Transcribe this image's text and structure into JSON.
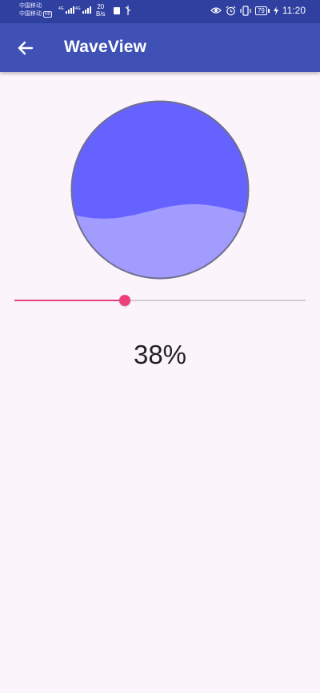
{
  "status_bar": {
    "carrier_1": "中国移动",
    "carrier_2": "中国移动",
    "hd_badge": "HD",
    "network_1": "4G",
    "network_2": "4G",
    "speed_value": "20",
    "speed_unit": "B/s",
    "battery_level": "79",
    "time": "11:20",
    "icons": [
      "sim-icon",
      "usb-icon",
      "eye-icon",
      "alarm-icon",
      "vibrate-icon",
      "battery-icon",
      "charging-icon"
    ]
  },
  "app_bar": {
    "title": "WaveView",
    "back_icon": "arrow-back-icon",
    "color": "#3f51b5"
  },
  "wave": {
    "progress": 0.38,
    "front_color": "#a39cff",
    "back_color": "#6662ff",
    "border_color": "#6f6f8f"
  },
  "slider": {
    "value": 38,
    "max": 100,
    "accent_color": "#ec407a"
  },
  "progress_label": "38%"
}
